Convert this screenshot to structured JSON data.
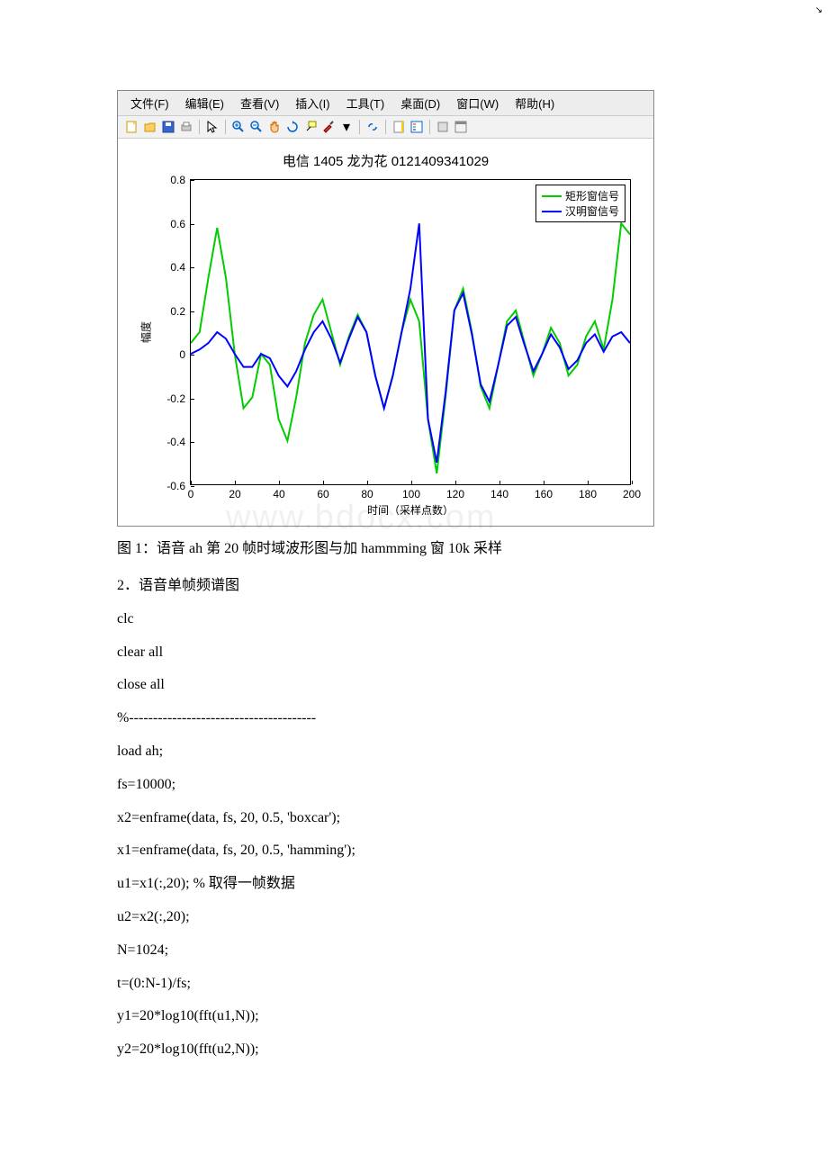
{
  "menubar": {
    "file": "文件(F)",
    "edit": "编辑(E)",
    "view": "查看(V)",
    "insert": "插入(I)",
    "tools": "工具(T)",
    "desktop": "桌面(D)",
    "window": "窗口(W)",
    "help": "帮助(H)"
  },
  "chart_data": {
    "type": "line",
    "title": "电信 1405 龙为花 0121409341029",
    "xlabel": "时间（采样点数）",
    "ylabel": "幅度",
    "xlim": [
      0,
      200
    ],
    "ylim": [
      -0.6,
      0.8
    ],
    "xticks": [
      0,
      20,
      40,
      60,
      80,
      100,
      120,
      140,
      160,
      180,
      200
    ],
    "yticks": [
      -0.6,
      -0.4,
      -0.2,
      0,
      0.2,
      0.4,
      0.6,
      0.8
    ],
    "legend": [
      "矩形窗信号",
      "汉明窗信号"
    ],
    "series": [
      {
        "name": "矩形窗信号",
        "color": "#00cc00",
        "x": [
          0,
          4,
          8,
          12,
          16,
          20,
          24,
          28,
          32,
          36,
          40,
          44,
          48,
          52,
          56,
          60,
          64,
          68,
          72,
          76,
          80,
          84,
          88,
          92,
          96,
          100,
          104,
          108,
          112,
          116,
          120,
          124,
          128,
          132,
          136,
          140,
          144,
          148,
          152,
          156,
          160,
          164,
          168,
          172,
          176,
          180,
          184,
          188,
          192,
          196,
          200
        ],
        "y": [
          0.05,
          0.1,
          0.35,
          0.58,
          0.35,
          0.0,
          -0.25,
          -0.2,
          0.0,
          -0.05,
          -0.3,
          -0.4,
          -0.2,
          0.05,
          0.18,
          0.25,
          0.1,
          -0.05,
          0.08,
          0.18,
          0.1,
          -0.1,
          -0.25,
          -0.1,
          0.1,
          0.25,
          0.15,
          -0.3,
          -0.55,
          -0.2,
          0.2,
          0.3,
          0.1,
          -0.15,
          -0.25,
          -0.05,
          0.15,
          0.2,
          0.05,
          -0.1,
          0.0,
          0.12,
          0.05,
          -0.1,
          -0.05,
          0.08,
          0.15,
          0.02,
          0.25,
          0.6,
          0.55
        ]
      },
      {
        "name": "汉明窗信号",
        "color": "#0000ff",
        "x": [
          0,
          4,
          8,
          12,
          16,
          20,
          24,
          28,
          32,
          36,
          40,
          44,
          48,
          52,
          56,
          60,
          64,
          68,
          72,
          76,
          80,
          84,
          88,
          92,
          96,
          100,
          104,
          108,
          112,
          116,
          120,
          124,
          128,
          132,
          136,
          140,
          144,
          148,
          152,
          156,
          160,
          164,
          168,
          172,
          176,
          180,
          184,
          188,
          192,
          196,
          200
        ],
        "y": [
          0.0,
          0.02,
          0.05,
          0.1,
          0.07,
          0.0,
          -0.06,
          -0.06,
          0.0,
          -0.02,
          -0.1,
          -0.15,
          -0.08,
          0.02,
          0.1,
          0.15,
          0.07,
          -0.04,
          0.07,
          0.17,
          0.1,
          -0.1,
          -0.25,
          -0.1,
          0.1,
          0.3,
          0.6,
          -0.3,
          -0.5,
          -0.18,
          0.2,
          0.28,
          0.09,
          -0.14,
          -0.22,
          -0.05,
          0.13,
          0.17,
          0.04,
          -0.08,
          0.0,
          0.09,
          0.03,
          -0.07,
          -0.03,
          0.05,
          0.09,
          0.01,
          0.08,
          0.1,
          0.05
        ]
      }
    ]
  },
  "caption": "图 1：语音 ah 第 20 帧时域波形图与加 hammming 窗 10k 采样",
  "section_heading": "2．语音单帧频谱图",
  "code": [
    "clc",
    "clear all",
    "close all",
    "%---------------------------------------",
    "load ah;",
    "fs=10000;",
    "x2=enframe(data, fs, 20, 0.5, 'boxcar');",
    "x1=enframe(data, fs, 20, 0.5, 'hamming');",
    "u1=x1(:,20); % 取得一帧数据",
    "u2=x2(:,20);",
    "N=1024;",
    "t=(0:N-1)/fs;",
    "y1=20*log10(fft(u1,N));",
    "y2=20*log10(fft(u2,N));"
  ],
  "watermark": "www.bdocx.com"
}
